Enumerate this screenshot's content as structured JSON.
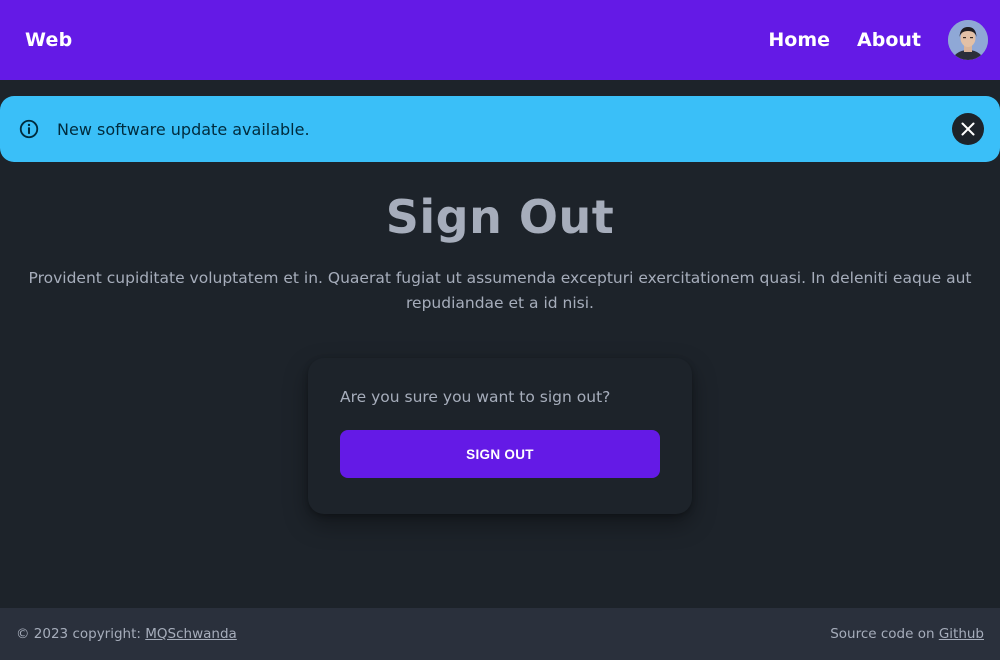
{
  "navbar": {
    "brand": "Web",
    "links": [
      {
        "label": "Home"
      },
      {
        "label": "About"
      }
    ],
    "avatar_icon": "user-avatar-photo"
  },
  "alert": {
    "icon": "info-circle-icon",
    "message": "New software update available.",
    "close_icon": "close-x-icon"
  },
  "hero": {
    "title": "Sign Out",
    "description": "Provident cupiditate voluptatem et in. Quaerat fugiat ut assumenda excepturi exercitationem quasi. In deleniti eaque aut repudiandae et a id nisi."
  },
  "card": {
    "prompt": "Are you sure you want to sign out?",
    "button_label": "SIGN OUT"
  },
  "footer": {
    "copyright_prefix": "© 2023 copyright:",
    "author_link": "MQSchwanda",
    "source_prefix": "Source code on",
    "source_link": "Github"
  },
  "colors": {
    "primary": "#641ae6",
    "info": "#3abff8",
    "background": "#1d232a",
    "footer": "#2a303c"
  }
}
